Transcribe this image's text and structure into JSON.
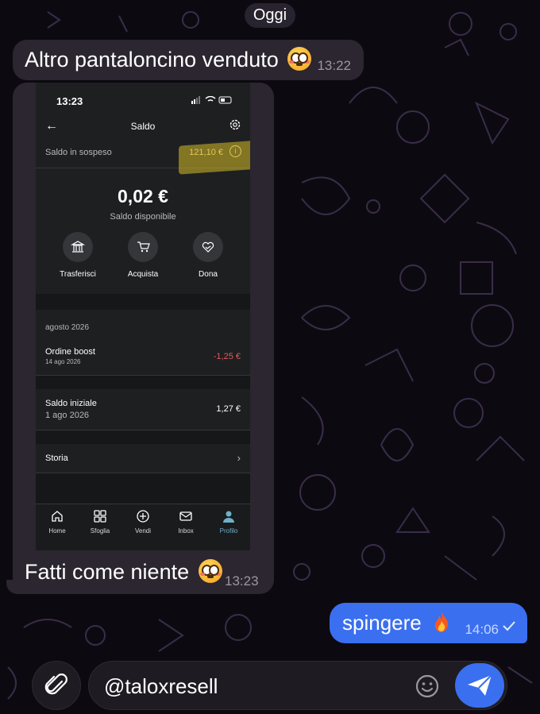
{
  "date_divider": "Oggi",
  "messages": {
    "m1": {
      "text": "Altro pantaloncino venduto",
      "time": "13:22"
    },
    "m2": {
      "caption": "Fatti come niente",
      "time": "13:23"
    },
    "m3": {
      "text": "spingere",
      "time": "14:06"
    }
  },
  "screenshot": {
    "status_time": "13:23",
    "header_title": "Saldo",
    "pending_label": "Saldo in sospeso",
    "pending_amount": "121,10 €",
    "balance": "0,02 €",
    "balance_label": "Saldo disponibile",
    "actions": [
      "Trasferisci",
      "Acquista",
      "Dona"
    ],
    "section_date": "agosto 2026",
    "rows": [
      {
        "title": "Ordine boost",
        "sub": "14 ago 2026",
        "amount": "-1,25 €"
      },
      {
        "title": "Saldo iniziale",
        "sub": "1 ago 2026",
        "amount": "1,27 €"
      }
    ],
    "history_label": "Storia",
    "tabs": [
      "Home",
      "Sfoglia",
      "Vendi",
      "Inbox",
      "Profilo"
    ],
    "active_tab": "Profilo"
  },
  "composer": {
    "value": "@taloxresell"
  },
  "colors": {
    "outgoing_bubble": "#3a6ff0",
    "incoming_bubble": "#2b262f",
    "negative_amount": "#e0585a"
  }
}
